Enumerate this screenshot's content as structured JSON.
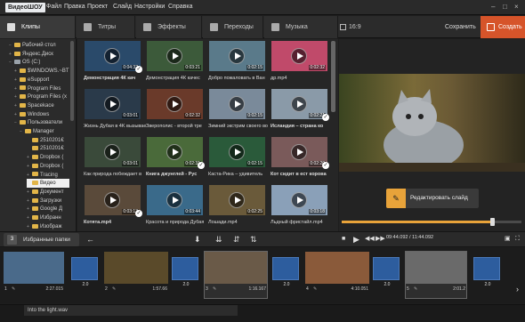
{
  "app": {
    "logo": "ВидеоШОУ",
    "menu": [
      "Файл",
      "Правка",
      "Проект",
      "Слайд",
      "Настройки",
      "Справка"
    ],
    "window_controls": [
      "–",
      "□",
      "×"
    ]
  },
  "tabs": [
    {
      "label": "Клипы",
      "icon": "clips-icon",
      "active": true
    },
    {
      "label": "Титры",
      "icon": "titles-icon",
      "active": false
    },
    {
      "label": "Эффекты",
      "icon": "effects-icon",
      "active": false
    },
    {
      "label": "Переходы",
      "icon": "transitions-icon",
      "active": false
    },
    {
      "label": "Музыка",
      "icon": "music-icon",
      "active": false
    }
  ],
  "header_right": {
    "ratio": "16:9",
    "save": "Сохранить",
    "create": "Создать"
  },
  "tree": [
    {
      "label": "Рабочий стол",
      "type": "folder",
      "toggle": "−"
    },
    {
      "label": "Яндекс.Диск",
      "type": "folder",
      "toggle": "+"
    },
    {
      "label": "OS (C:)",
      "type": "drive",
      "toggle": "−"
    },
    {
      "label": "$WINDOWS.~BT",
      "type": "folder",
      "toggle": "+"
    },
    {
      "label": "eSupport",
      "type": "folder",
      "toggle": "+"
    },
    {
      "label": "Program Files",
      "type": "folder",
      "toggle": "+"
    },
    {
      "label": "Program Files (x",
      "type": "folder",
      "toggle": "+"
    },
    {
      "label": "Spacekace",
      "type": "folder",
      "toggle": "+"
    },
    {
      "label": "Windows",
      "type": "folder",
      "toggle": "+"
    },
    {
      "label": "Пользователи",
      "type": "folder",
      "toggle": "−"
    },
    {
      "label": "Manager",
      "type": "folder",
      "toggle": "−"
    },
    {
      "label": "2510201€",
      "type": "folder",
      "toggle": ""
    },
    {
      "label": "2510201€",
      "type": "folder",
      "toggle": ""
    },
    {
      "label": "Dropbox (",
      "type": "folder",
      "toggle": "+"
    },
    {
      "label": "Dropbox (",
      "type": "folder",
      "toggle": "+"
    },
    {
      "label": "Tracing",
      "type": "folder",
      "toggle": "+"
    },
    {
      "label": "Видео",
      "type": "folder",
      "toggle": "",
      "selected": true
    },
    {
      "label": "Документ",
      "type": "folder",
      "toggle": "+"
    },
    {
      "label": "Загрузки",
      "type": "folder",
      "toggle": "+"
    },
    {
      "label": "Google Д",
      "type": "folder",
      "toggle": "+"
    },
    {
      "label": "Избранн",
      "type": "folder",
      "toggle": "+"
    },
    {
      "label": "Изображ",
      "type": "folder",
      "toggle": "+"
    }
  ],
  "files": [
    {
      "caption": "Демонстрация 4К кач",
      "bold": true,
      "dur": "0:04:32",
      "color": "#2a4a6a",
      "checked": true
    },
    {
      "caption": "Демонстрация 4К качес",
      "bold": false,
      "dur": "0:03:21",
      "color": "#3c5a3a",
      "checked": false
    },
    {
      "caption": "Добро пожаловать в Ван",
      "bold": false,
      "dur": "0:02:15",
      "color": "#5a7a8a",
      "checked": false
    },
    {
      "caption": "др.mp4",
      "bold": false,
      "dur": "0:02:32",
      "color": "#c04a6a",
      "checked": false
    },
    {
      "caption": "Жизнь Дубая в 4K вызывает",
      "bold": false,
      "dur": "0:03:01",
      "color": "#2a3a4a",
      "checked": false
    },
    {
      "caption": "Зверополис - второй тре",
      "bold": false,
      "dur": "0:02:32",
      "color": "#6a3a2a",
      "checked": false
    },
    {
      "caption": "Зимний экстрим своего во",
      "bold": false,
      "dur": "0:02:15",
      "color": "#7a8a9a",
      "checked": false
    },
    {
      "caption": "Исландия – страна ко",
      "bold": true,
      "dur": "0:02:21",
      "color": "#8a9aa8",
      "checked": true
    },
    {
      "caption": "Как природа побеждает в",
      "bold": false,
      "dur": "0:03:01",
      "color": "#3a4a3a",
      "checked": false
    },
    {
      "caption": "Книга джунглей - Рус",
      "bold": true,
      "dur": "0:02:31",
      "color": "#4a6a3a",
      "checked": true
    },
    {
      "caption": "Каста-Рика – удивитель",
      "bold": false,
      "dur": "0:02:15",
      "color": "#2a5a3a",
      "checked": false
    },
    {
      "caption": "Кот сидит в ест корова",
      "bold": true,
      "dur": "0:02:20",
      "color": "#7a5a5a",
      "checked": true
    },
    {
      "caption": "Котята.mp4",
      "bold": true,
      "dur": "0:03:13",
      "color": "#5a4a3a",
      "checked": true
    },
    {
      "caption": "Красота и природа Дубая",
      "bold": false,
      "dur": "0:03:44",
      "color": "#3a6a8a",
      "checked": false
    },
    {
      "caption": "Лошади.mp4",
      "bold": false,
      "dur": "0:02:25",
      "color": "#6a5a3a",
      "checked": false
    },
    {
      "caption": "Льдный фристайл.mp4",
      "bold": false,
      "dur": "0:03:18",
      "color": "#8aa0b8",
      "checked": false
    }
  ],
  "preview": {
    "edit_label": "Редактировать слайд",
    "progress": 0.84
  },
  "toolbar": {
    "fav_num": "3",
    "fav_label": "Избранные папки",
    "time": "09:44.092 / 11:44.092"
  },
  "timeline": {
    "slides": [
      {
        "n": "1",
        "dur": "2:27.015",
        "color": "#4a6a8a"
      },
      {
        "n": "2",
        "dur": "1:57.66",
        "color": "#5a4a2a"
      },
      {
        "n": "3",
        "dur": "1:16.167",
        "color": "#6a5a48",
        "selected": true
      },
      {
        "n": "4",
        "dur": "4:10.051",
        "color": "#8a5a3a"
      },
      {
        "n": "5",
        "dur": "2:01.2",
        "color": "#6a6a6a",
        "selected": true
      }
    ],
    "transitions": [
      "2.0",
      "2.0",
      "2.0",
      "2.0",
      "2.0"
    ],
    "audio_clip": "Into the light.wav"
  }
}
